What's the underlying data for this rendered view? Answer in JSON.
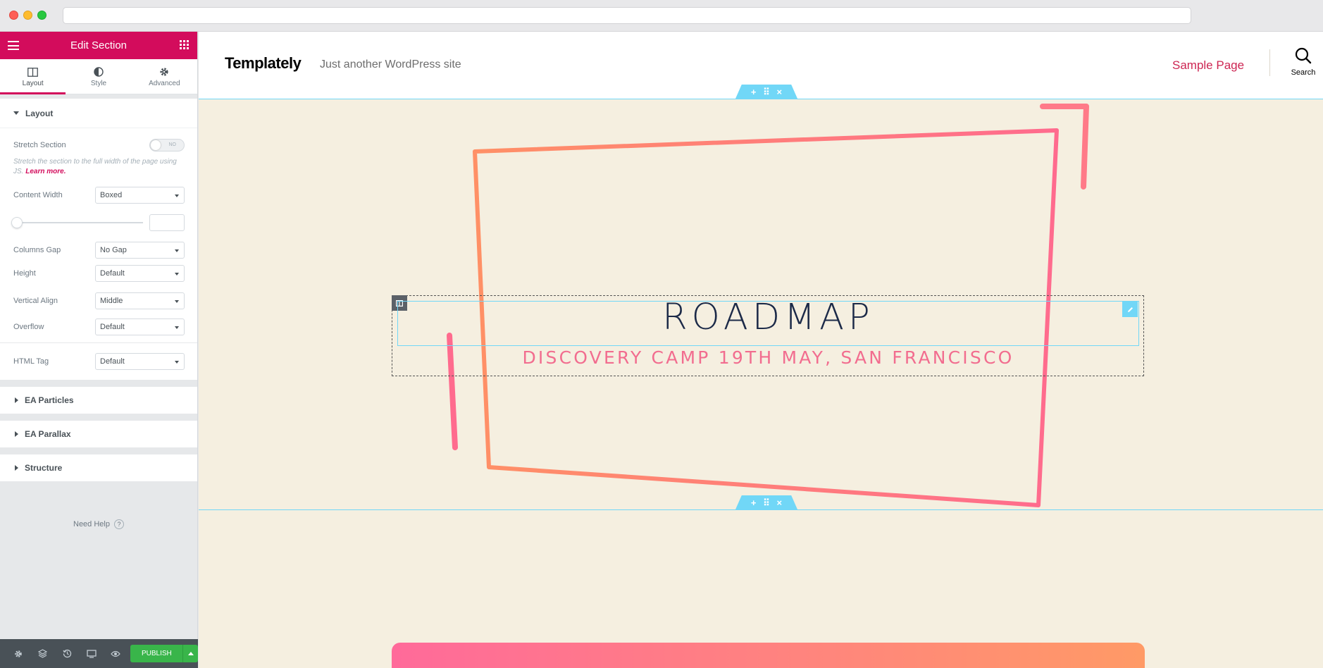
{
  "panel": {
    "title": "Edit Section",
    "tabs": [
      {
        "label": "Layout",
        "icon": "layout-icon"
      },
      {
        "label": "Style",
        "icon": "style-icon"
      },
      {
        "label": "Advanced",
        "icon": "gear-icon"
      }
    ],
    "layout_section": {
      "heading": "Layout",
      "stretch_section": {
        "label": "Stretch Section",
        "toggle_text": "NO",
        "enabled": false
      },
      "stretch_desc": "Stretch the section to the full width of the page using JS.",
      "learn_more": "Learn more.",
      "content_width": {
        "label": "Content Width",
        "value": "Boxed"
      },
      "width_slider": {
        "value": "",
        "fraction": 0
      },
      "columns_gap": {
        "label": "Columns Gap",
        "value": "No Gap"
      },
      "height": {
        "label": "Height",
        "value": "Default"
      },
      "vertical_align": {
        "label": "Vertical Align",
        "value": "Middle"
      },
      "overflow": {
        "label": "Overflow",
        "value": "Default"
      },
      "html_tag": {
        "label": "HTML Tag",
        "value": "Default"
      }
    },
    "collapsed_sections": [
      "EA Particles",
      "EA Parallax",
      "Structure"
    ],
    "need_help": "Need Help",
    "footer": {
      "publish_label": "PUBLISH"
    }
  },
  "site": {
    "logo": "Templately",
    "tagline": "Just another WordPress site",
    "nav_item": "Sample Page",
    "search_label": "Search"
  },
  "hero": {
    "heading": "ROADMAP",
    "subheading": "DISCOVERY CAMP 19TH MAY, SAN FRANCISCO"
  },
  "colors": {
    "accent": "#d30c5c",
    "section_bg": "#f5efe0",
    "editor_highlight": "#71d7f7",
    "publish": "#39b54a",
    "heading": "#1c2a48",
    "subheading": "#f26d8f",
    "nav_link": "#cd2653"
  }
}
